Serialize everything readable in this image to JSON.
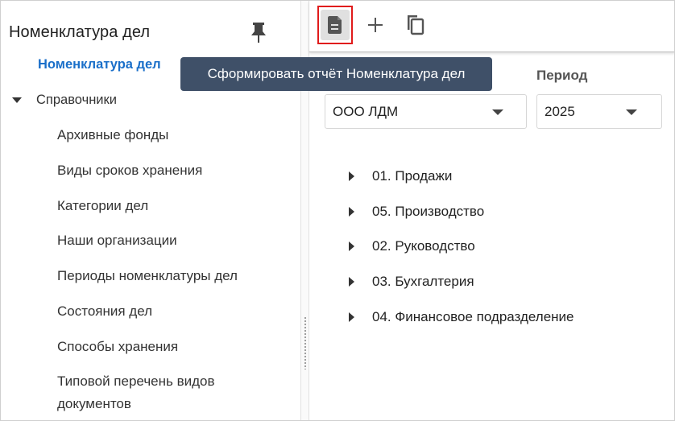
{
  "sidebar": {
    "title": "Номенклатура дел",
    "active_item": "Номенклатура дел",
    "group_label": "Справочники",
    "items": [
      "Архивные фонды",
      "Виды сроков хранения",
      "Категории дел",
      "Наши организации",
      "Периоды номенклатуры дел",
      "Состояния дел",
      "Способы хранения",
      "Типовой перечень видов документов"
    ]
  },
  "toolbar": {
    "buttons": [
      {
        "icon": "report-document-icon",
        "highlighted": true
      },
      {
        "icon": "plus-icon"
      },
      {
        "icon": "copy-icon"
      }
    ],
    "tooltip": "Сформировать отчёт Номенклатура дел",
    "highlight_color": "#e01b1b"
  },
  "filters": {
    "period_label": "Период",
    "organization_value": "ООО ЛДМ",
    "period_value": "2025"
  },
  "tree": {
    "items": [
      "01. Продажи",
      "05. Производство",
      "02. Руководство",
      "03. Бухгалтерия",
      "04. Финансовое подразделение"
    ]
  },
  "colors": {
    "accent": "#1a6fc9",
    "tooltip_bg": "#3f5068"
  }
}
